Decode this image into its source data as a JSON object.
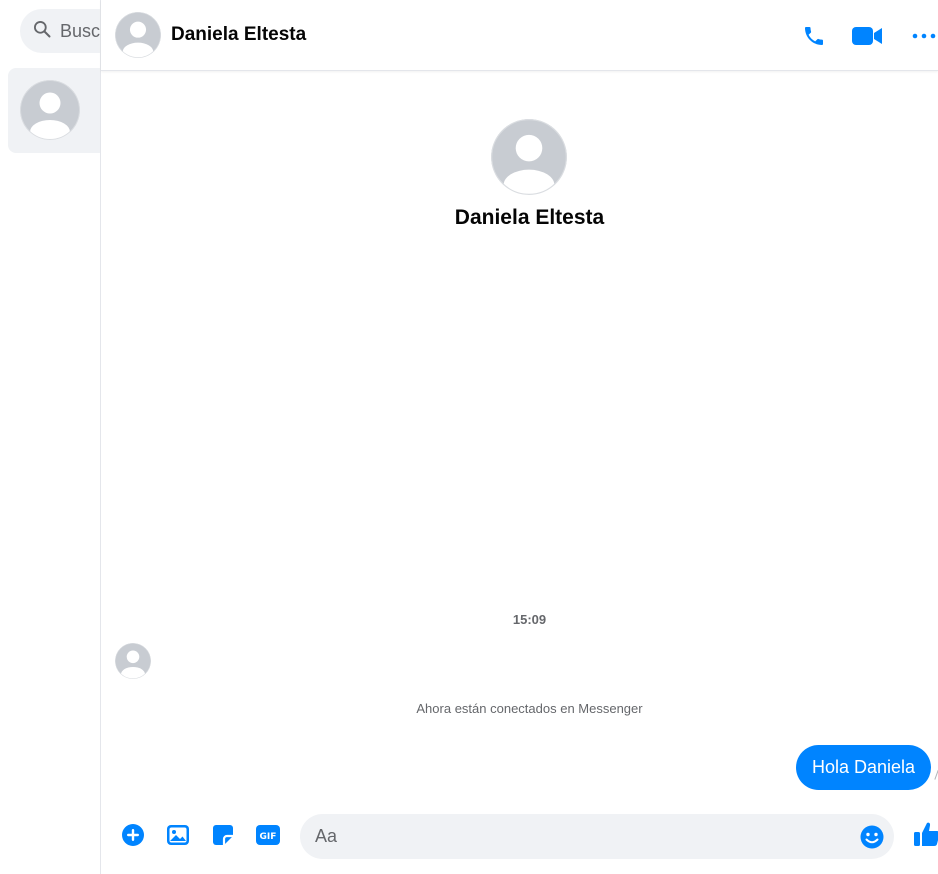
{
  "sidebar": {
    "search_placeholder": "Buscar en Messenger"
  },
  "header": {
    "contact_name": "Daniela Eltesta"
  },
  "profile": {
    "name": "Daniela Eltesta"
  },
  "conversation": {
    "timestamp": "15:09",
    "system_message": "Ahora están conectados en Messenger",
    "sent_message": "Hola Daniela"
  },
  "composer": {
    "placeholder": "Aa"
  },
  "colors": {
    "accent": "#0084ff",
    "field_bg": "#f0f2f5",
    "muted_text": "#65676b"
  },
  "icons": {
    "search": "search-icon",
    "phone": "phone-icon",
    "video": "video-camera-icon",
    "more": "more-dots-icon",
    "plus": "plus-circle-icon",
    "image": "image-icon",
    "sticker": "sticker-icon",
    "gif": "gif-icon",
    "emoji": "emoji-icon",
    "like": "thumbs-up-icon"
  }
}
